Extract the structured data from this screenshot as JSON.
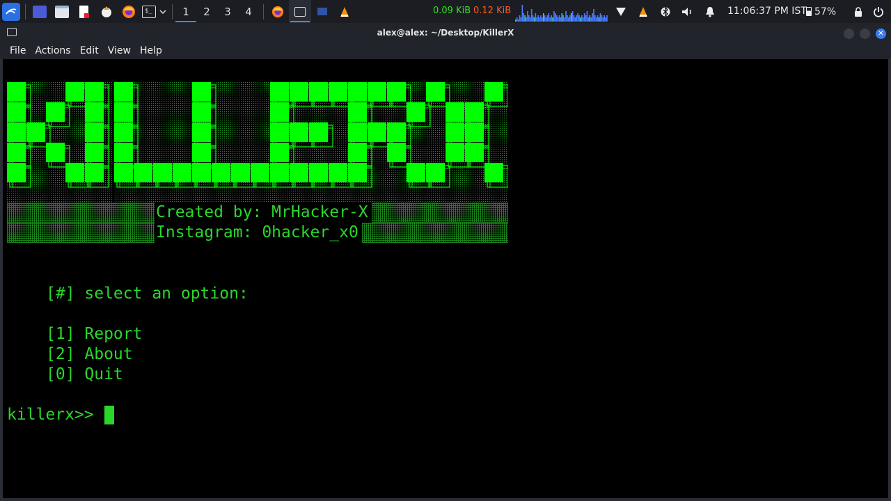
{
  "panel": {
    "workspaces": [
      "1",
      "2",
      "3",
      "4"
    ],
    "active_workspace": "1",
    "net_down": "0.09 KiB",
    "net_up": "0.12 KiB",
    "clock": "11:06:37 PM IST",
    "battery": "57%",
    "accent": "#3d8bff",
    "net_down_color": "#33e61c",
    "net_up_color": "#ff5a1f",
    "net_graph": [
      1,
      2,
      1,
      3,
      2,
      8,
      4,
      3,
      2,
      5,
      3,
      2,
      6,
      3,
      2,
      4,
      2,
      3,
      2,
      3,
      2,
      4,
      3,
      2,
      3,
      4,
      2,
      3,
      2,
      5,
      4,
      3,
      2,
      3,
      2,
      4,
      3,
      2,
      5,
      3,
      2,
      3,
      4,
      5,
      3,
      2,
      3,
      4,
      3,
      2,
      3,
      2,
      4,
      3,
      5,
      2,
      3,
      2,
      4,
      6,
      3,
      2,
      3,
      2,
      4,
      3,
      2,
      3,
      2,
      3
    ]
  },
  "window": {
    "title": "alex@alex: ~/Desktop/KillerX",
    "menu": [
      "File",
      "Actions",
      "Edit",
      "View",
      "Help"
    ]
  },
  "terminal": {
    "banner_word": "KILLERX",
    "credit_line1": "Created by: MrHacker-X",
    "credit_line2": "Instagram: 0hacker_x0",
    "select_prompt": "[#] select an option:",
    "options": [
      "[1] Report",
      "[2] About",
      "[0] Quit"
    ],
    "shell_prompt": "killerx>> ",
    "text_color": "#2bd62b",
    "block_color": "#00ff00"
  }
}
